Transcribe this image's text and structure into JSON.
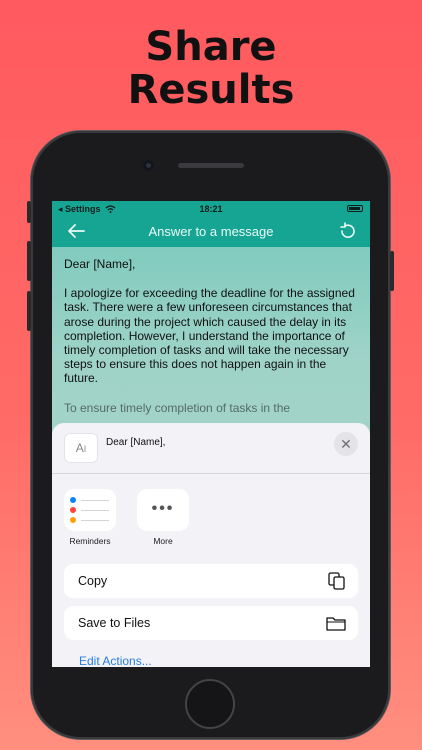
{
  "promo": {
    "headline_line1": "Share",
    "headline_line2": "Results"
  },
  "status_bar": {
    "carrier": "◂ Settings",
    "time": "18:21"
  },
  "nav": {
    "title": "Answer to a message",
    "back_icon": "arrow-left-icon",
    "reset_icon": "rotate-ccw-icon"
  },
  "message": {
    "greeting": "Dear [Name],",
    "paragraph": "I apologize for exceeding the deadline for the assigned task. There were a few unforeseen circumstances that arose during the project which caused the delay in its completion. However, I understand the importance of timely completion of tasks and will take the necessary steps to ensure this does not happen again in the future.",
    "partial_line": "To ensure timely completion of tasks in the"
  },
  "share_sheet": {
    "preview_title": "Dear [Name],",
    "doc_icon_glyph": "A",
    "close_glyph": "✕",
    "apps": [
      {
        "label": "Reminders",
        "icon": "reminders-icon"
      },
      {
        "label": "More",
        "icon": "more-icon"
      }
    ],
    "reminder_colors": [
      "#0a84ff",
      "#ff453a",
      "#ff9f0a"
    ],
    "actions": [
      {
        "label": "Copy",
        "icon": "copy-icon"
      },
      {
        "label": "Save to Files",
        "icon": "folder-icon"
      }
    ],
    "edit_actions": "Edit Actions..."
  },
  "colors": {
    "background": "#ff5a5f",
    "accent": "#17a593",
    "link": "#2a7ee0"
  }
}
